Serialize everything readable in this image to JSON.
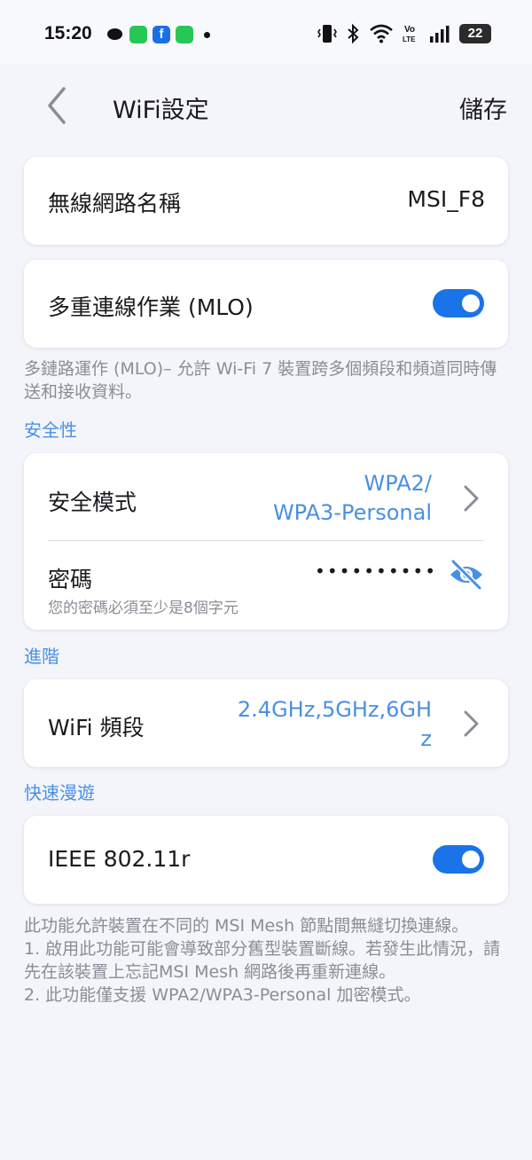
{
  "status_bar": {
    "time": "15:20",
    "battery": "22",
    "icons": [
      "chat-bubble-icon",
      "line-icon",
      "facebook-icon",
      "app-icon",
      "vibrate-icon",
      "bluetooth-icon",
      "wifi-icon",
      "volte-icon",
      "signal-icon",
      "battery-icon"
    ],
    "volte": "Vo\nLTE"
  },
  "header": {
    "title": "WiFi設定",
    "save_label": "儲存"
  },
  "network_name": {
    "label": "無線網路名稱",
    "value": "MSI_F8"
  },
  "mlo": {
    "label": "多重連線作業 (MLO)",
    "enabled": true,
    "description": "多鏈路運作 (MLO)– 允許 Wi-Fi 7 裝置跨多個頻段和頻道同時傳送和接收資料。"
  },
  "security": {
    "section_title": "安全性",
    "mode_label": "安全模式",
    "mode_value_line1": "WPA2/",
    "mode_value_line2": "WPA3-Personal",
    "password_label": "密碼",
    "password_hint": "您的密碼必須至少是8個字元",
    "password_masked": "••••••••••"
  },
  "advanced": {
    "section_title": "進階",
    "band_label": "WiFi 頻段",
    "band_value_line1": "2.4GHz,5GHz,6GH",
    "band_value_line2": "z"
  },
  "roaming": {
    "section_title": "快速漫遊",
    "label": "IEEE 802.11r",
    "enabled": true,
    "desc_line1": "此功能允許裝置在不同的 MSI Mesh 節點間無縫切換連線。",
    "desc_line2": "1. 啟用此功能可能會導致部分舊型裝置斷線。若發生此情況，請先在該裝置上忘記MSI Mesh 網路後再重新連線。",
    "desc_line3": "2. 此功能僅支援 WPA2/WPA3-Personal 加密模式。"
  },
  "colors": {
    "accent": "#1a73e8",
    "link_blue": "#4a90e2",
    "background": "#f4f5fa"
  }
}
